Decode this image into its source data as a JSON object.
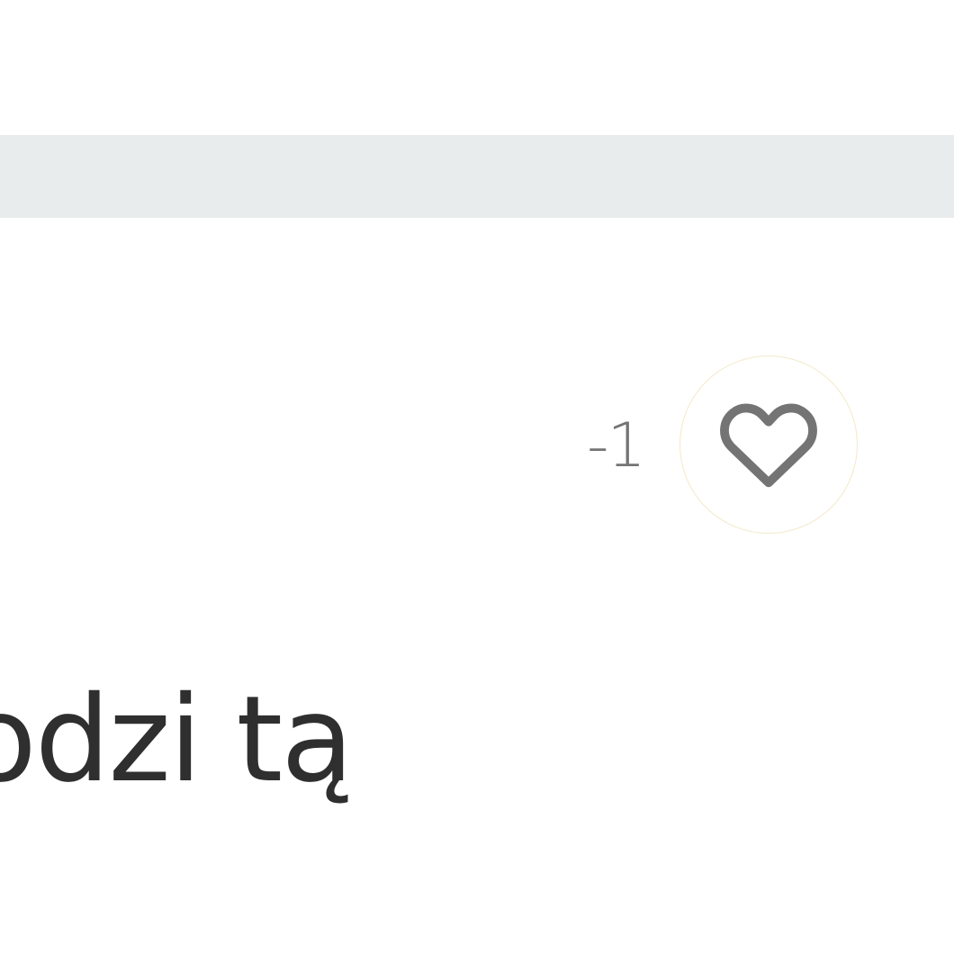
{
  "comment": {
    "like_count": "-1",
    "text": "odzi tą"
  },
  "icons": {
    "like": "heart-outline-icon"
  },
  "colors": {
    "band": "#e9eced",
    "text": "#2f2f2f",
    "muted": "#747474",
    "ring": "#f3e9c9"
  }
}
